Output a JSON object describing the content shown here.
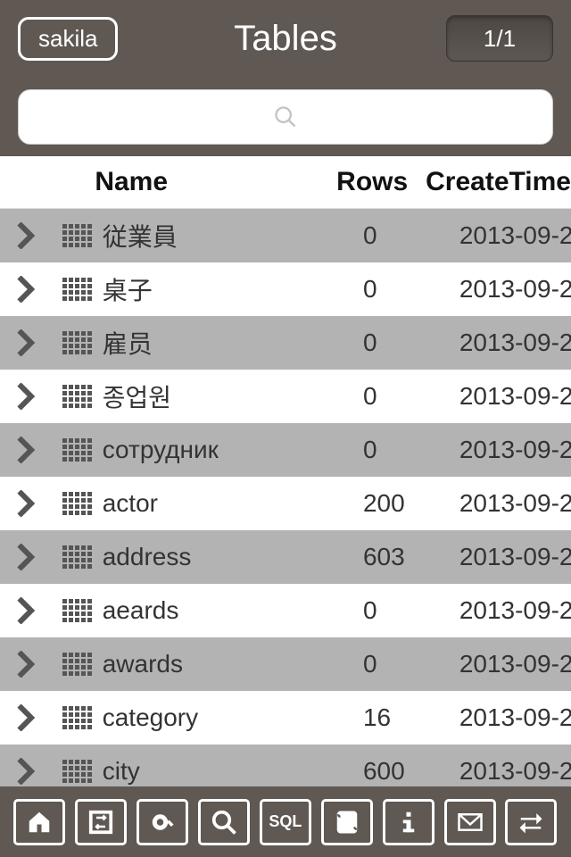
{
  "header": {
    "database": "sakila",
    "title": "Tables",
    "page_indicator": "1/1"
  },
  "search": {
    "placeholder": ""
  },
  "columns": {
    "name": "Name",
    "rows": "Rows",
    "create": "CreateTime"
  },
  "tables": [
    {
      "name": "従業員",
      "rows": "0",
      "create": "2013-09-2"
    },
    {
      "name": "桌子",
      "rows": "0",
      "create": "2013-09-2"
    },
    {
      "name": "雇员",
      "rows": "0",
      "create": "2013-09-2"
    },
    {
      "name": "종업원",
      "rows": "0",
      "create": "2013-09-2"
    },
    {
      "name": "сотрудник",
      "rows": "0",
      "create": "2013-09-2"
    },
    {
      "name": "actor",
      "rows": "200",
      "create": "2013-09-2"
    },
    {
      "name": "address",
      "rows": "603",
      "create": "2013-09-2"
    },
    {
      "name": "aeards",
      "rows": "0",
      "create": "2013-09-2"
    },
    {
      "name": "awards",
      "rows": "0",
      "create": "2013-09-2"
    },
    {
      "name": "category",
      "rows": "16",
      "create": "2013-09-2"
    },
    {
      "name": "city",
      "rows": "600",
      "create": "2013-09-2"
    }
  ],
  "toolbar": {
    "sql_label": "SQL"
  }
}
